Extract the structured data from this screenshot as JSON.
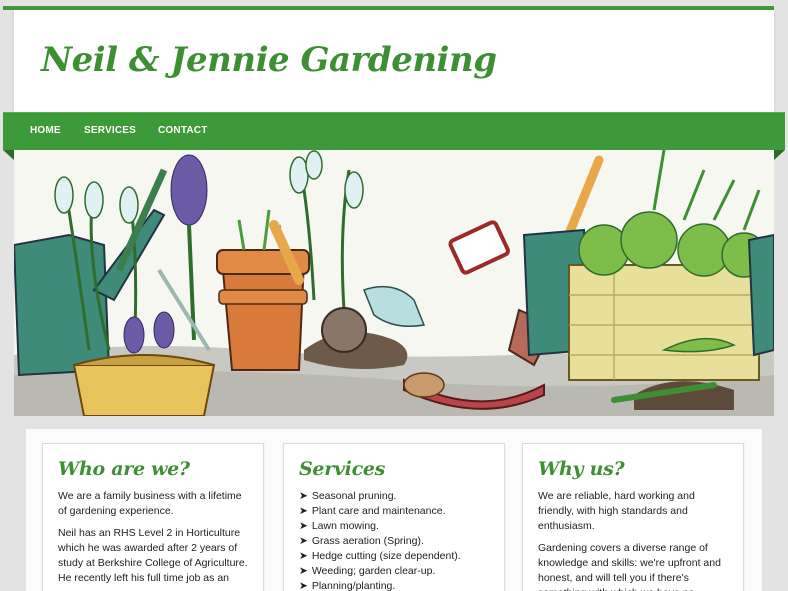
{
  "site": {
    "title": "Neil & Jennie Gardening"
  },
  "nav": {
    "items": [
      "HOME",
      "SERVICES",
      "CONTACT"
    ]
  },
  "colors": {
    "brand_green": "#3e8f34",
    "nav_green": "#3d9a38"
  },
  "hero": {
    "image": "garden-illustration"
  },
  "cards": {
    "who": {
      "title": "Who are we?",
      "p1": "We are a family business with a lifetime of gardening experience.",
      "p2": "Neil has an RHS Level 2 in Horticulture which he was awarded after 2 years of study at Berkshire College of Agriculture. He recently left his full time job as an"
    },
    "services": {
      "title": "Services",
      "items": [
        "Seasonal pruning.",
        "Plant care and maintenance.",
        "Lawn mowing.",
        "Grass aeration (Spring).",
        "Hedge cutting (size dependent).",
        "Weeding; garden clear-up.",
        "Planning/planting."
      ]
    },
    "why": {
      "title": "Why us?",
      "p1": "We are reliable, hard working and friendly, with high standards and enthusiasm.",
      "p2": "Gardening covers a diverse range of knowledge and skills: we're upfront and honest, and will tell you if there's something with which we have no"
    }
  }
}
